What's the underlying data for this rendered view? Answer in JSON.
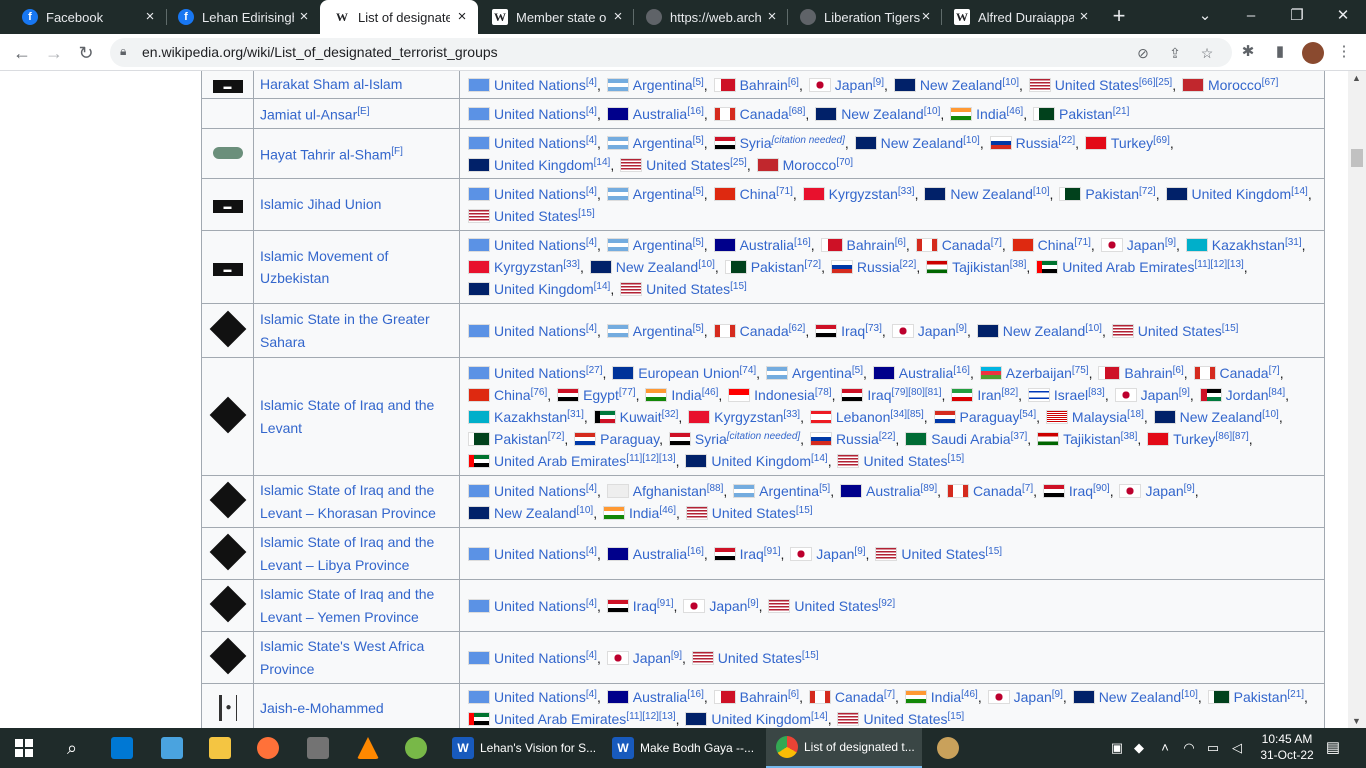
{
  "browser": {
    "tabs": [
      {
        "title": "Facebook",
        "icon": "facebook-icon"
      },
      {
        "title": "Lehan Edirisinghe",
        "icon": "facebook-icon"
      },
      {
        "title": "List of designated",
        "icon": "wikipedia-icon"
      },
      {
        "title": "Member state of",
        "icon": "wikipedia-icon"
      },
      {
        "title": "https://web.archi",
        "icon": "globe-icon"
      },
      {
        "title": "Liberation Tigers",
        "icon": "globe-icon"
      },
      {
        "title": "Alfred Duraiappa",
        "icon": "wikipedia-icon"
      }
    ],
    "url": "en.wikipedia.org/wiki/List_of_designated_terrorist_groups"
  },
  "rows": [
    {
      "name": "Harakat Sham al-Islam",
      "logo": "black-flag",
      "countries": [
        {
          "c": "United Nations",
          "f": "un",
          "r": "[4]"
        },
        {
          "c": "Argentina",
          "f": "ar",
          "r": "[5]"
        },
        {
          "c": "Bahrain",
          "f": "bh",
          "r": "[6]"
        },
        {
          "c": "Japan",
          "f": "jp",
          "r": "[9]"
        },
        {
          "c": "New Zealand",
          "f": "nz",
          "r": "[10]"
        },
        {
          "c": "United States",
          "f": "us",
          "r": "[66][25]"
        },
        {
          "c": "Morocco",
          "f": "ma",
          "r": "[67]"
        }
      ]
    },
    {
      "name": "Jamiat ul-Ansar",
      "note": "[E]",
      "logo": "none",
      "countries": [
        {
          "c": "United Nations",
          "f": "un",
          "r": "[4]"
        },
        {
          "c": "Australia",
          "f": "au",
          "r": "[16]"
        },
        {
          "c": "Canada",
          "f": "ca",
          "r": "[68]"
        },
        {
          "c": "New Zealand",
          "f": "nz",
          "r": "[10]"
        },
        {
          "c": "India",
          "f": "in",
          "r": "[46]"
        },
        {
          "c": "Pakistan",
          "f": "pk",
          "r": "[21]"
        }
      ]
    },
    {
      "name": "Hayat Tahrir al-Sham",
      "note": "[F]",
      "logo": "green-flag",
      "countries": [
        {
          "c": "United Nations",
          "f": "un",
          "r": "[4]"
        },
        {
          "c": "Argentina",
          "f": "ar",
          "r": "[5]"
        },
        {
          "c": "Syria",
          "f": "sy",
          "r": "[citation needed]"
        },
        {
          "c": "New Zealand",
          "f": "nz",
          "r": "[10]"
        },
        {
          "c": "Russia",
          "f": "ru",
          "r": "[22]"
        },
        {
          "c": "Turkey",
          "f": "tr",
          "r": "[69]"
        },
        {
          "c": "United Kingdom",
          "f": "gb",
          "r": "[14]"
        },
        {
          "c": "United States",
          "f": "us",
          "r": "[25]"
        },
        {
          "c": "Morocco",
          "f": "ma",
          "r": "[70]"
        }
      ]
    },
    {
      "name": "Islamic Jihad Union",
      "logo": "black-flag",
      "countries": [
        {
          "c": "United Nations",
          "f": "un",
          "r": "[4]"
        },
        {
          "c": "Argentina",
          "f": "ar",
          "r": "[5]"
        },
        {
          "c": "China",
          "f": "cn",
          "r": "[71]"
        },
        {
          "c": "Kyrgyzstan",
          "f": "kg",
          "r": "[33]"
        },
        {
          "c": "New Zealand",
          "f": "nz",
          "r": "[10]"
        },
        {
          "c": "Pakistan",
          "f": "pk",
          "r": "[72]"
        },
        {
          "c": "United Kingdom",
          "f": "gb",
          "r": "[14]"
        },
        {
          "c": "United States",
          "f": "us",
          "r": "[15]"
        }
      ]
    },
    {
      "name": "Islamic Movement of Uzbekistan",
      "logo": "black-flag",
      "countries": [
        {
          "c": "United Nations",
          "f": "un",
          "r": "[4]"
        },
        {
          "c": "Argentina",
          "f": "ar",
          "r": "[5]"
        },
        {
          "c": "Australia",
          "f": "au",
          "r": "[16]"
        },
        {
          "c": "Bahrain",
          "f": "bh",
          "r": "[6]"
        },
        {
          "c": "Canada",
          "f": "ca",
          "r": "[7]"
        },
        {
          "c": "China",
          "f": "cn",
          "r": "[71]"
        },
        {
          "c": "Japan",
          "f": "jp",
          "r": "[9]"
        },
        {
          "c": "Kazakhstan",
          "f": "kz",
          "r": "[31]"
        },
        {
          "c": "Kyrgyzstan",
          "f": "kg",
          "r": "[33]"
        },
        {
          "c": "New Zealand",
          "f": "nz",
          "r": "[10]"
        },
        {
          "c": "Pakistan",
          "f": "pk",
          "r": "[72]"
        },
        {
          "c": "Russia",
          "f": "ru",
          "r": "[22]"
        },
        {
          "c": "Tajikistan",
          "f": "tj",
          "r": "[38]"
        },
        {
          "c": "United Arab Emirates",
          "f": "ae",
          "r": "[11][12][13]"
        },
        {
          "c": "United Kingdom",
          "f": "gb",
          "r": "[14]"
        },
        {
          "c": "United States",
          "f": "us",
          "r": "[15]"
        }
      ]
    },
    {
      "name": "Islamic State in the Greater Sahara",
      "logo": "isis-seal",
      "countries": [
        {
          "c": "United Nations",
          "f": "un",
          "r": "[4]"
        },
        {
          "c": "Argentina",
          "f": "ar",
          "r": "[5]"
        },
        {
          "c": "Canada",
          "f": "ca",
          "r": "[62]"
        },
        {
          "c": "Iraq",
          "f": "iq",
          "r": "[73]"
        },
        {
          "c": "Japan",
          "f": "jp",
          "r": "[9]"
        },
        {
          "c": "New Zealand",
          "f": "nz",
          "r": "[10]"
        },
        {
          "c": "United States",
          "f": "us",
          "r": "[15]"
        }
      ]
    },
    {
      "name": "Islamic State of Iraq and the Levant",
      "logo": "isis-seal",
      "countries": [
        {
          "c": "United Nations",
          "f": "un",
          "r": "[27]"
        },
        {
          "c": "European Union",
          "f": "eu",
          "r": "[74]"
        },
        {
          "c": "Argentina",
          "f": "ar",
          "r": "[5]"
        },
        {
          "c": "Australia",
          "f": "au",
          "r": "[16]"
        },
        {
          "c": "Azerbaijan",
          "f": "az",
          "r": "[75]"
        },
        {
          "c": "Bahrain",
          "f": "bh",
          "r": "[6]"
        },
        {
          "c": "Canada",
          "f": "ca",
          "r": "[7]"
        },
        {
          "c": "China",
          "f": "cn",
          "r": "[76]"
        },
        {
          "c": "Egypt",
          "f": "eg",
          "r": "[77]"
        },
        {
          "c": "India",
          "f": "in",
          "r": "[46]"
        },
        {
          "c": "Indonesia",
          "f": "id",
          "r": "[78]"
        },
        {
          "c": "Iraq",
          "f": "iq",
          "r": "[79][80][81]"
        },
        {
          "c": "Iran",
          "f": "ir",
          "r": "[82]"
        },
        {
          "c": "Israel",
          "f": "il",
          "r": "[83]"
        },
        {
          "c": "Japan",
          "f": "jp",
          "r": "[9]"
        },
        {
          "c": "Jordan",
          "f": "jo",
          "r": "[84]"
        },
        {
          "c": "Kazakhstan",
          "f": "kz",
          "r": "[31]"
        },
        {
          "c": "Kuwait",
          "f": "kw",
          "r": "[32]"
        },
        {
          "c": "Kyrgyzstan",
          "f": "kg",
          "r": "[33]"
        },
        {
          "c": "Lebanon",
          "f": "lb",
          "r": "[34][85]"
        },
        {
          "c": "Paraguay",
          "f": "py",
          "r": "[54]"
        },
        {
          "c": "Malaysia",
          "f": "my",
          "r": "[18]"
        },
        {
          "c": "New Zealand",
          "f": "nz",
          "r": "[10]"
        },
        {
          "c": "Pakistan",
          "f": "pk",
          "r": "[72]"
        },
        {
          "c": "Paraguay",
          "f": "py",
          "r": ""
        },
        {
          "c": "Syria",
          "f": "sy",
          "r": "[citation needed]"
        },
        {
          "c": "Russia",
          "f": "ru",
          "r": "[22]"
        },
        {
          "c": "Saudi Arabia",
          "f": "sa",
          "r": "[37]"
        },
        {
          "c": "Tajikistan",
          "f": "tj",
          "r": "[38]"
        },
        {
          "c": "Turkey",
          "f": "tr",
          "r": "[86][87]"
        },
        {
          "c": "United Arab Emirates",
          "f": "ae",
          "r": "[11][12][13]"
        },
        {
          "c": "United Kingdom",
          "f": "gb",
          "r": "[14]"
        },
        {
          "c": "United States",
          "f": "us",
          "r": "[15]"
        }
      ]
    },
    {
      "name": "Islamic State of Iraq and the Levant – Khorasan Province",
      "logo": "isis-seal",
      "countries": [
        {
          "c": "United Nations",
          "f": "un",
          "r": "[4]"
        },
        {
          "c": "Afghanistan",
          "f": "af",
          "r": "[88]"
        },
        {
          "c": "Argentina",
          "f": "ar",
          "r": "[5]"
        },
        {
          "c": "Australia",
          "f": "au",
          "r": "[89]"
        },
        {
          "c": "Canada",
          "f": "ca",
          "r": "[7]"
        },
        {
          "c": "Iraq",
          "f": "iq",
          "r": "[90]"
        },
        {
          "c": "Japan",
          "f": "jp",
          "r": "[9]"
        },
        {
          "c": "New Zealand",
          "f": "nz",
          "r": "[10]"
        },
        {
          "c": "India",
          "f": "in",
          "r": "[46]"
        },
        {
          "c": "United States",
          "f": "us",
          "r": "[15]"
        }
      ]
    },
    {
      "name": "Islamic State of Iraq and the Levant – Libya Province",
      "logo": "isis-seal",
      "countries": [
        {
          "c": "United Nations",
          "f": "un",
          "r": "[4]"
        },
        {
          "c": "Australia",
          "f": "au",
          "r": "[16]"
        },
        {
          "c": "Iraq",
          "f": "iq",
          "r": "[91]"
        },
        {
          "c": "Japan",
          "f": "jp",
          "r": "[9]"
        },
        {
          "c": "United States",
          "f": "us",
          "r": "[15]"
        }
      ]
    },
    {
      "name": "Islamic State of Iraq and the Levant – Yemen Province",
      "logo": "isis-seal",
      "countries": [
        {
          "c": "United Nations",
          "f": "un",
          "r": "[4]"
        },
        {
          "c": "Iraq",
          "f": "iq",
          "r": "[91]"
        },
        {
          "c": "Japan",
          "f": "jp",
          "r": "[9]"
        },
        {
          "c": "United States",
          "f": "us",
          "r": "[92]"
        }
      ]
    },
    {
      "name": "Islamic State's West Africa Province",
      "logo": "isis-seal",
      "countries": [
        {
          "c": "United Nations",
          "f": "un",
          "r": "[4]"
        },
        {
          "c": "Japan",
          "f": "jp",
          "r": "[9]"
        },
        {
          "c": "United States",
          "f": "us",
          "r": "[15]"
        }
      ]
    },
    {
      "name": "Jaish-e-Mohammed",
      "logo": "jem-flag",
      "countries": [
        {
          "c": "United Nations",
          "f": "un",
          "r": "[4]"
        },
        {
          "c": "Australia",
          "f": "au",
          "r": "[16]"
        },
        {
          "c": "Bahrain",
          "f": "bh",
          "r": "[6]"
        },
        {
          "c": "Canada",
          "f": "ca",
          "r": "[7]"
        },
        {
          "c": "India",
          "f": "in",
          "r": "[46]"
        },
        {
          "c": "Japan",
          "f": "jp",
          "r": "[9]"
        },
        {
          "c": "New Zealand",
          "f": "nz",
          "r": "[10]"
        },
        {
          "c": "Pakistan",
          "f": "pk",
          "r": "[21]"
        },
        {
          "c": "United Arab Emirates",
          "f": "ae",
          "r": "[11][12][13]"
        },
        {
          "c": "United Kingdom",
          "f": "gb",
          "r": "[14]"
        },
        {
          "c": "United States",
          "f": "us",
          "r": "[15]"
        }
      ]
    }
  ],
  "taskbar": {
    "tasks": [
      {
        "label": "Lehan's Vision for S...",
        "app": "word"
      },
      {
        "label": "Make Bodh Gaya --...",
        "app": "word"
      },
      {
        "label": "List of designated t...",
        "app": "chrome"
      }
    ],
    "time": "10:45 AM",
    "date": "31-Oct-22"
  }
}
